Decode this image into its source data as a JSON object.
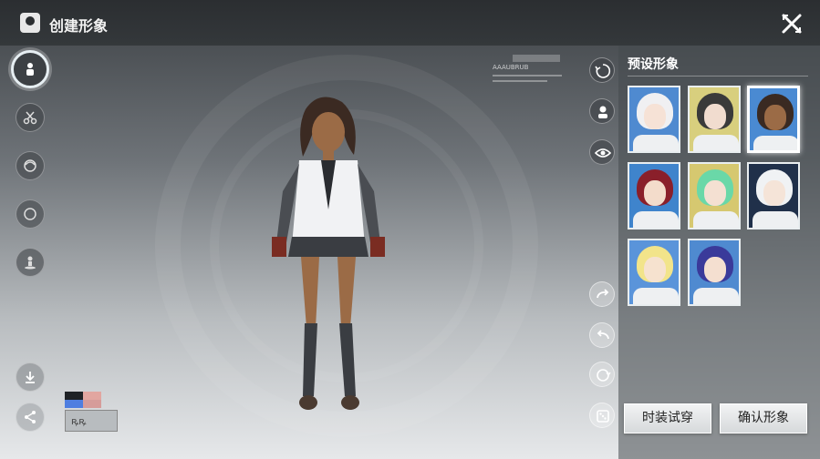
{
  "header": {
    "title": "创建形象"
  },
  "hud": {
    "tag": "YARENO",
    "caption": "AAAUBRUB"
  },
  "colors": {
    "swatch_black": "#1f2226",
    "swatch_pink": "#e2a6a0",
    "swatch_blue": "#4f7ee0",
    "swatch_rose": "#d69c9a"
  },
  "pattern_label": "ꝶꝶ",
  "panel": {
    "title": "预设形象",
    "presets": [
      {
        "name": "preset-1",
        "hair": "#f0f0f2",
        "skin": "#f6e2d6",
        "bg": "#4f8ad0"
      },
      {
        "name": "preset-2",
        "hair": "#3a3a3a",
        "skin": "#f1dccf",
        "bg": "#d8cf7e"
      },
      {
        "name": "preset-3",
        "hair": "#3a2a22",
        "skin": "#9b6b46",
        "bg": "#4a8ad2"
      },
      {
        "name": "preset-4",
        "hair": "#8a1f2a",
        "skin": "#f3dccb",
        "bg": "#3f84cc"
      },
      {
        "name": "preset-5",
        "hair": "#6ad8a8",
        "skin": "#f4e0d2",
        "bg": "#d6c870"
      },
      {
        "name": "preset-6",
        "hair": "#f0f2f4",
        "skin": "#f5e4d8",
        "bg": "#20304a"
      },
      {
        "name": "preset-7",
        "hair": "#f2e48a",
        "skin": "#f6e2cf",
        "bg": "#5a94da"
      },
      {
        "name": "preset-8",
        "hair": "#3a3a9a",
        "skin": "#f4dfd0",
        "bg": "#4f8ad0"
      }
    ],
    "selected_index": 2
  },
  "buttons": {
    "try_outfit": "时装试穿",
    "confirm": "确认形象"
  }
}
